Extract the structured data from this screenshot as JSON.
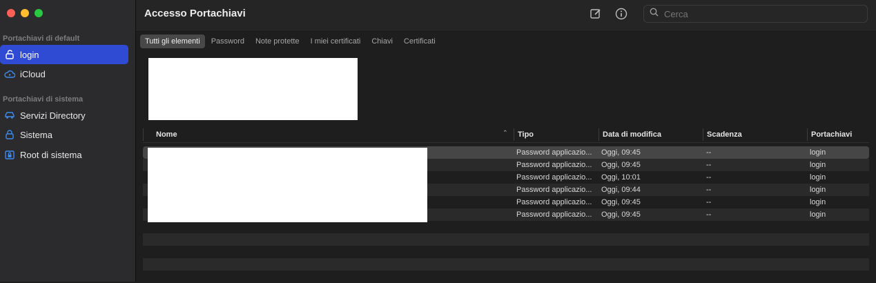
{
  "sidebar": {
    "default_section": "Portachiavi di default",
    "system_section": "Portachiavi di sistema",
    "items": [
      {
        "label": "login",
        "icon": "unlock-icon"
      },
      {
        "label": "iCloud",
        "icon": "cloud-icon"
      },
      {
        "label": "Servizi Directory",
        "icon": "car-icon"
      },
      {
        "label": "Sistema",
        "icon": "lock-icon"
      },
      {
        "label": "Root di sistema",
        "icon": "lock-box-icon"
      }
    ]
  },
  "header": {
    "title": "Accesso Portachiavi",
    "search_placeholder": "Cerca"
  },
  "tabs": [
    "Tutti gli elementi",
    "Password",
    "Note protette",
    "I miei certificati",
    "Chiavi",
    "Certificati"
  ],
  "table": {
    "columns": [
      "Nome",
      "Tipo",
      "Data di modifica",
      "Scadenza",
      "Portachiavi"
    ],
    "rows": [
      {
        "tipo": "Password applicazio...",
        "data": "Oggi, 09:45",
        "scadenza": "--",
        "portachiavi": "login"
      },
      {
        "tipo": "Password applicazio...",
        "data": "Oggi, 09:45",
        "scadenza": "--",
        "portachiavi": "login"
      },
      {
        "tipo": "Password applicazio...",
        "data": "Oggi, 10:01",
        "scadenza": "--",
        "portachiavi": "login"
      },
      {
        "tipo": "Password applicazio...",
        "data": "Oggi, 09:44",
        "scadenza": "--",
        "portachiavi": "login"
      },
      {
        "tipo": "Password applicazio...",
        "data": "Oggi, 09:45",
        "scadenza": "--",
        "portachiavi": "login"
      },
      {
        "tipo": "Password applicazio...",
        "data": "Oggi, 09:45",
        "scadenza": "--",
        "portachiavi": "login"
      }
    ]
  },
  "colors": {
    "selection": "#2f4bd4",
    "sidebar_bg": "#2b2a2c",
    "content_bg": "#1e1e1e"
  }
}
